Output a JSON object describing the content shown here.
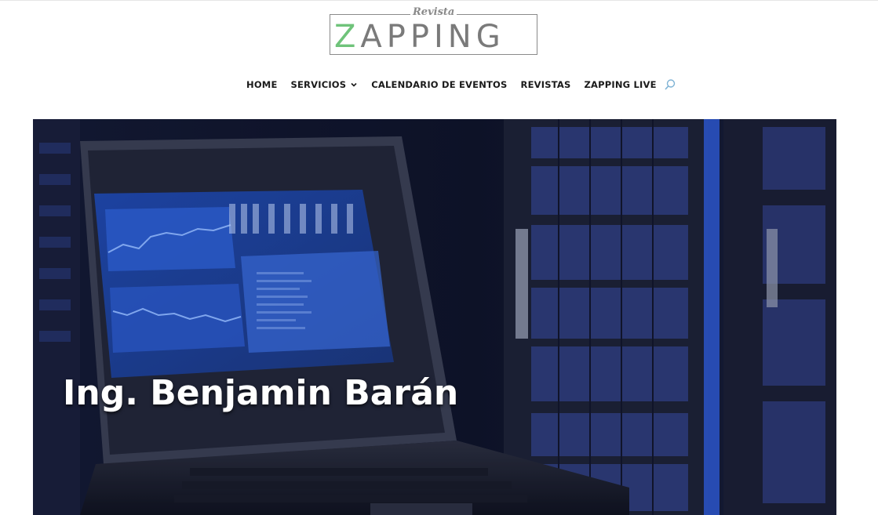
{
  "logo": {
    "top_text": "Revista",
    "first_letter": "Z",
    "rest": "APPING"
  },
  "nav": {
    "items": [
      {
        "label": "HOME"
      },
      {
        "label": "SERVICIOS"
      },
      {
        "label": "CALENDARIO DE EVENTOS"
      },
      {
        "label": "REVISTAS"
      },
      {
        "label": "ZAPPING LIVE"
      }
    ]
  },
  "hero": {
    "title": "Ing. Benjamin Barán"
  },
  "colors": {
    "brand_green": "#6fc37a",
    "nav_text": "#1a1a1a",
    "search_icon": "#7fb3d5"
  },
  "icons": [
    "chevron-down-icon",
    "search-icon"
  ]
}
